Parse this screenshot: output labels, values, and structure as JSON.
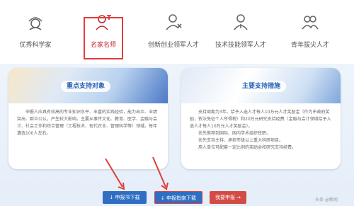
{
  "tabs": [
    {
      "label": "优秀科学家",
      "icon": "scientist-icon"
    },
    {
      "label": "名家名师",
      "icon": "master-teacher-icon"
    },
    {
      "label": "创新创业领军人才",
      "icon": "innovation-leader-icon"
    },
    {
      "label": "技术技能领军人才",
      "icon": "skill-leader-icon"
    },
    {
      "label": "青年拔尖人才",
      "icon": "youth-talent-icon"
    }
  ],
  "left_card": {
    "title": "重点支持对象",
    "body": "申报人应具有较高的专业知识水平、丰富的实践经验，能力出众、业绩突出、群众公认，产生较大影响。主要从事传文化、教育、医学、金融与会计、社会工作和综合管理（工程技术、现代农业、管理科学等）领域。每年遴选100人左右。"
  },
  "right_card": {
    "title": "主要支持措施",
    "lines": [
      "支持周期为3年。给予入选人才每人10万元人才奖励金（作为市政府奖励，依法免征个人所得税）和20万元研究支持经费（金融与会计领域给予入选人才每人10万元人才奖励金）。",
      "优先推荐到国际、国内学术组织任职。",
      "优先支持主持、承担市级以上重大科研项目。",
      "用人单位可配套一定比例的奖励金和研究支持经费。"
    ]
  },
  "buttons": {
    "download_form": "↓ 申报书下载",
    "download_guide": "↓ 申报指南下载",
    "apply": "我要申报 →"
  },
  "watermark": "头条 @新闻",
  "colors": {
    "accent_red": "#c0282c",
    "button_blue": "#2f6ec2",
    "button_red": "#d44a45",
    "title_blue": "#2a63b8"
  }
}
